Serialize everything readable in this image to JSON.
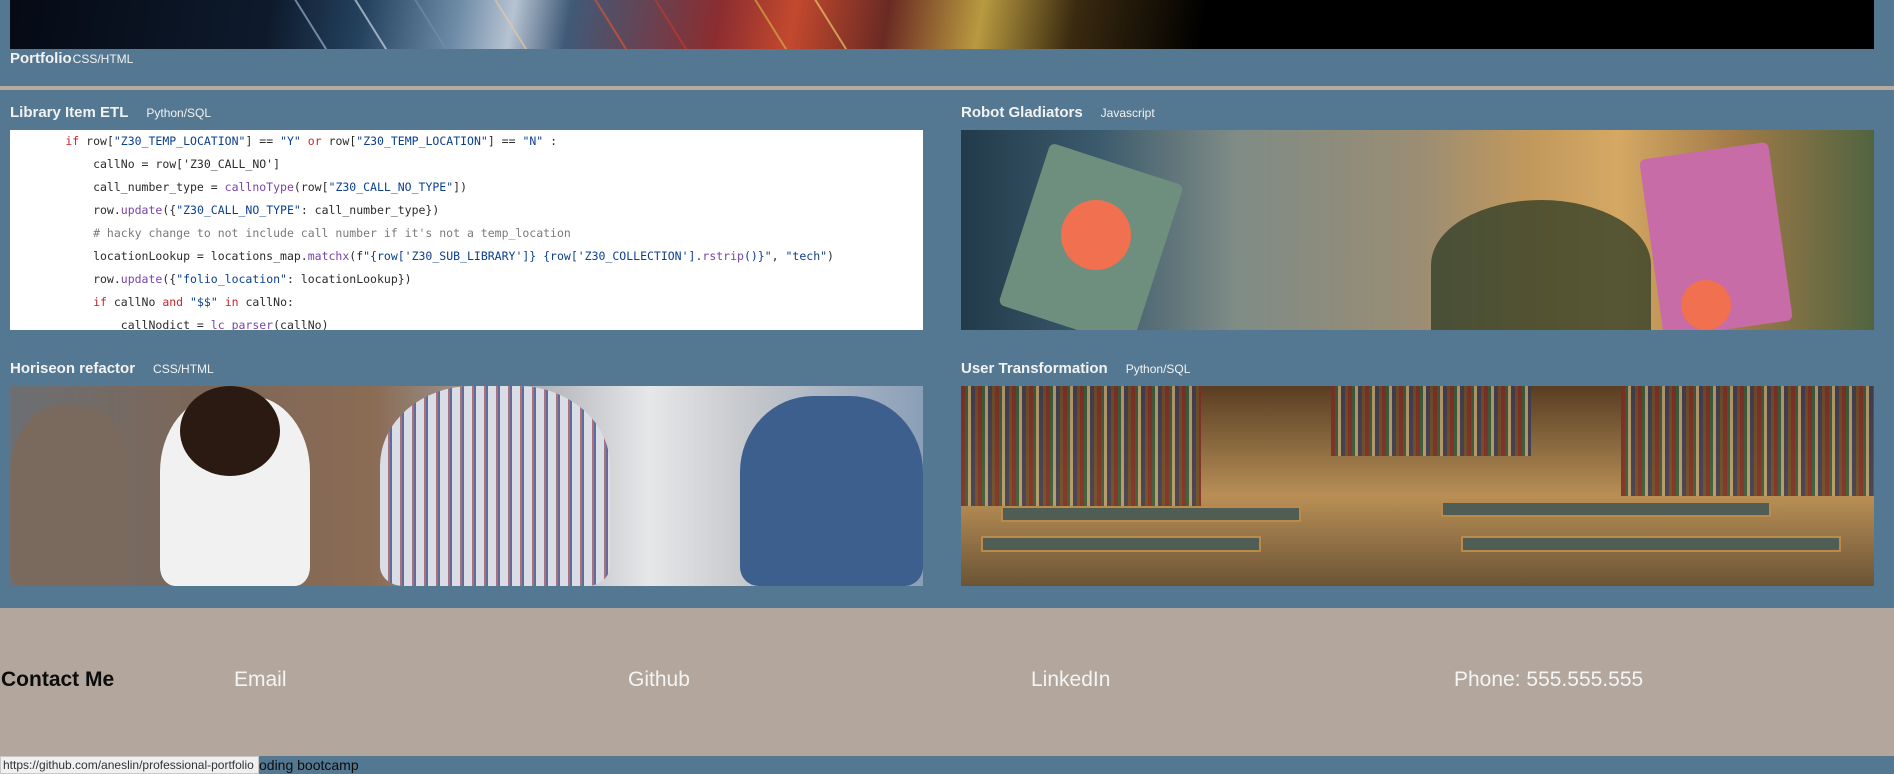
{
  "header": {
    "title": "Portfolio",
    "subtitle": "CSS/HTML"
  },
  "projects": [
    {
      "title": "Library Item ETL",
      "lang": "Python/SQL",
      "image": "code-screenshot"
    },
    {
      "title": "Robot Gladiators",
      "lang": "Javascript",
      "image": "robot-image"
    },
    {
      "title": "Horiseon refactor",
      "lang": "CSS/HTML",
      "image": "team-image"
    },
    {
      "title": "User Transformation",
      "lang": "Python/SQL",
      "image": "library-image"
    }
  ],
  "code_lines": [
    "        if row[\"Z30_TEMP_LOCATION\"] == \"Y\" or row[\"Z30_TEMP_LOCATION\"] == \"N\" :",
    "            callNo = row['Z30_CALL_NO']",
    "            call_number_type = callnoType(row[\"Z30_CALL_NO_TYPE\"])",
    "            row.update({\"Z30_CALL_NO_TYPE\": call_number_type})",
    "            # hacky change to not include call number if it's not a temp_location",
    "            locationLookup = locations_map.matchx(f\"{row['Z30_SUB_LIBRARY']} {row['Z30_COLLECTION'].rstrip()}\", \"tech\")",
    "            row.update({\"folio_location\": locationLookup})",
    "            if callNo and \"$$\" in callNo:",
    "                callNodict = lc_parser(callNo)"
  ],
  "contact": {
    "heading": "Contact Me",
    "email": "Email",
    "github": "Github",
    "linkedin": "LinkedIn",
    "phone": "Phone: 555.555.555"
  },
  "footer": {
    "text": "oding bootcamp"
  },
  "status_bar": {
    "url": "https://github.com/aneslin/professional-portfolio"
  },
  "colors": {
    "page_bg": "#547891",
    "divider": "#b7aaa0",
    "contact_bg": "#b2a69d",
    "text_light": "#f2f2f2"
  }
}
